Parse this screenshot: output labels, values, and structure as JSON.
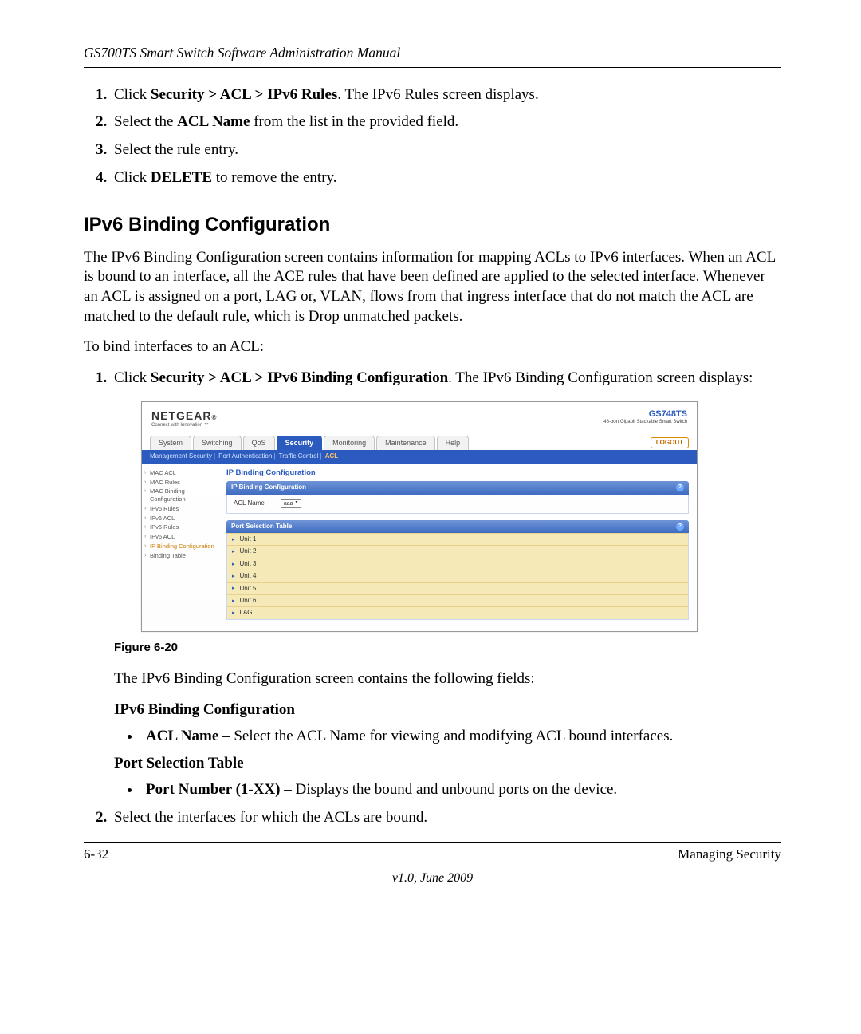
{
  "header": "GS700TS Smart Switch Software Administration Manual",
  "steps_a": [
    {
      "pre": "Click ",
      "b": "Security > ACL > IPv6 Rules",
      "post": ". The IPv6 Rules screen displays."
    },
    {
      "pre": "Select the ",
      "b": "ACL Name",
      "post": " from the list in the provided field."
    },
    {
      "pre": "Select the rule entry.",
      "b": "",
      "post": ""
    },
    {
      "pre": "Click ",
      "b": "DELETE",
      "post": " to remove the entry."
    }
  ],
  "section_heading": "IPv6 Binding Configuration",
  "para1": "The IPv6 Binding Configuration screen contains information for mapping ACLs to IPv6 interfaces. When an ACL is bound to an interface, all the ACE rules that have been defined are applied to the selected interface. Whenever an ACL is assigned on a port, LAG or, VLAN, flows from that ingress interface that do not match the ACL are matched to the default rule, which is Drop unmatched packets.",
  "para2": "To bind interfaces to an ACL:",
  "steps_b_1": {
    "pre": "Click ",
    "b": "Security > ACL > IPv6 Binding Configuration",
    "post": ". The IPv6 Binding Configuration screen displays:"
  },
  "figure_label": "Figure 6-20",
  "after_figure": "The IPv6 Binding Configuration screen contains the following fields:",
  "sub1": "IPv6 Binding Configuration",
  "bullet1": {
    "b": "ACL Name",
    "post": " – Select the ACL Name for viewing and modifying ACL bound interfaces."
  },
  "sub2": "Port Selection Table",
  "bullet2": {
    "b": "Port Number (1-XX)",
    "post": " – Displays the bound and unbound ports on the device."
  },
  "steps_b_2": "Select the interfaces for which the ACLs are bound.",
  "footer": {
    "page": "6-32",
    "right": "Managing Security",
    "version": "v1.0, June 2009"
  },
  "ui": {
    "brand": "NETGEAR",
    "brand_sub": "Connect with Innovation ™",
    "model": "GS748TS",
    "model_sub": "48-port Gigabit Stackable Smart Switch",
    "tabs": [
      "System",
      "Switching",
      "QoS",
      "Security",
      "Monitoring",
      "Maintenance",
      "Help"
    ],
    "active_tab": "Security",
    "logout": "LOGOUT",
    "subnav": [
      "Management Security",
      "Port Authentication",
      "Traffic Control",
      "ACL"
    ],
    "subnav_active": "ACL",
    "side": [
      "MAC ACL",
      "MAC Rules",
      "MAC Binding Configuration",
      "IPv6 Rules",
      "IPv6 ACL",
      "IPv6 Rules",
      "IPv6 ACL",
      "IP Binding Configuration",
      "Binding Table"
    ],
    "side_sel": "IP Binding Configuration",
    "panel_title": "IP Binding Configuration",
    "panel_header": "IP Binding Configuration",
    "acl_label": "ACL Name",
    "acl_value": "aaa",
    "port_header": "Port Selection Table",
    "port_rows": [
      "Unit 1",
      "Unit 2",
      "Unit 3",
      "Unit 4",
      "Unit 5",
      "Unit 6",
      "LAG"
    ]
  }
}
